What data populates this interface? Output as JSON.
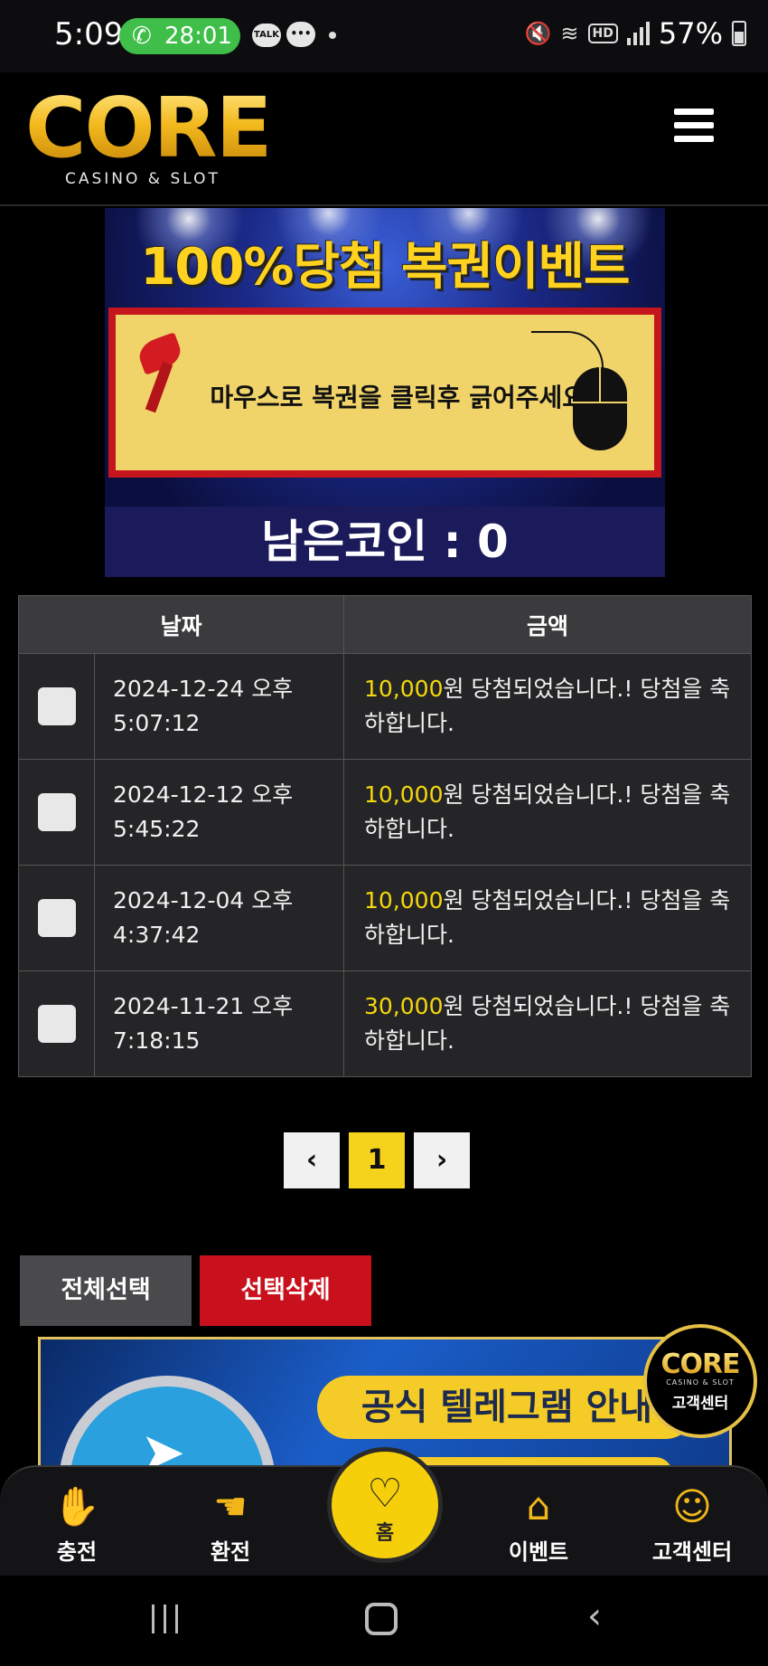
{
  "status_bar": {
    "time": "5:09",
    "call_duration": "28:01",
    "talk_badge": "TALK",
    "hd_badge": "HD",
    "battery": "57%"
  },
  "header": {
    "logo_text": "CORE",
    "logo_sub": "CASINO & SLOT"
  },
  "lottery": {
    "title": "100%당첨 복권이벤트",
    "instruction": "마우스로 복권을 클릭후 긁어주세요",
    "remaining_coins": "남은코인 : 0"
  },
  "table": {
    "headers": [
      "날짜",
      "금액"
    ],
    "rows": [
      {
        "date": "2024-12-24 오후",
        "time": "5:07:12",
        "amount": "10,000",
        "message": "원 당첨되었습니다.! 당첨을 축하합니다."
      },
      {
        "date": "2024-12-12 오후",
        "time": "5:45:22",
        "amount": "10,000",
        "message": "원 당첨되었습니다.! 당첨을 축하합니다."
      },
      {
        "date": "2024-12-04 오후",
        "time": "4:37:42",
        "amount": "10,000",
        "message": "원 당첨되었습니다.! 당첨을 축하합니다."
      },
      {
        "date": "2024-11-21 오후",
        "time": "7:18:15",
        "amount": "30,000",
        "message": "원 당첨되었습니다.! 당첨을 축하합니다."
      }
    ]
  },
  "pagination": {
    "prev": "‹",
    "current": "1",
    "next": "›"
  },
  "actions": {
    "select_all": "전체선택",
    "delete_selected": "선택삭제"
  },
  "telegram_banner": {
    "text": "공식 텔레그램 안내"
  },
  "cs_badge": {
    "logo": "CORE",
    "logo_sub": "CASINO & SLOT",
    "label": "고객센터"
  },
  "bottom_nav": {
    "deposit": "충전",
    "withdraw": "환전",
    "home": "홈",
    "event": "이벤트",
    "support": "고객센터"
  },
  "colors": {
    "accent_yellow": "#f5d21b",
    "delete_red": "#c9111e",
    "money_yellow": "#f5d80b"
  }
}
